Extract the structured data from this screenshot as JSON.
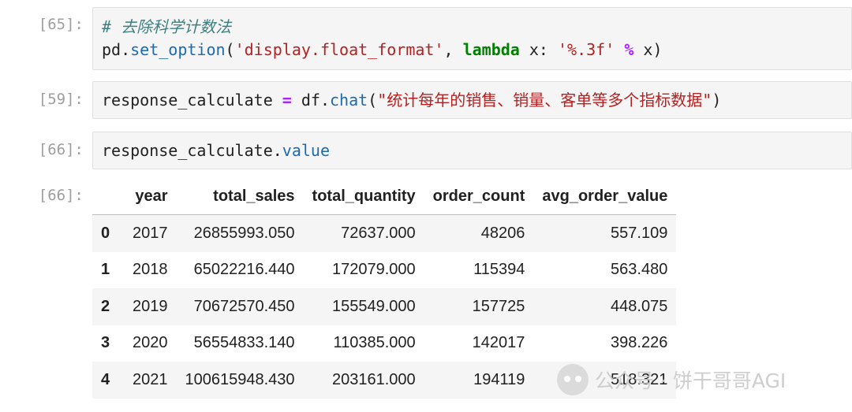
{
  "cells": [
    {
      "prompt": "[65]:",
      "comment": "# 去除科学计数法",
      "code": {
        "part1": "pd.",
        "fn": "set_option",
        "part2": "(",
        "str1": "'display.float_format'",
        "part3": ", ",
        "kw": "lambda",
        "part4": " x: ",
        "str2": "'%.3f'",
        "part5": " ",
        "op": "%",
        "part6": " x)"
      }
    },
    {
      "prompt": "[59]:",
      "code": {
        "part1": "response_calculate ",
        "op": "=",
        "part2": " df.",
        "fn": "chat",
        "part3": "(",
        "str": "\"统计每年的销售、销量、客单等多个指标数据\"",
        "part4": ")"
      }
    },
    {
      "prompt": "[66]:",
      "code": {
        "part1": "response_calculate.",
        "fn": "value"
      }
    }
  ],
  "output": {
    "prompt": "[66]:",
    "columns": [
      "year",
      "total_sales",
      "total_quantity",
      "order_count",
      "avg_order_value"
    ],
    "rows": [
      {
        "index": "0",
        "values": [
          "2017",
          "26855993.050",
          "72637.000",
          "48206",
          "557.109"
        ]
      },
      {
        "index": "1",
        "values": [
          "2018",
          "65022216.440",
          "172079.000",
          "115394",
          "563.480"
        ]
      },
      {
        "index": "2",
        "values": [
          "2019",
          "70672570.450",
          "155549.000",
          "157725",
          "448.075"
        ]
      },
      {
        "index": "3",
        "values": [
          "2020",
          "56554833.140",
          "110385.000",
          "142017",
          "398.226"
        ]
      },
      {
        "index": "4",
        "values": [
          "2021",
          "100615948.430",
          "203161.000",
          "194119",
          "518.321"
        ]
      }
    ]
  },
  "watermark": {
    "text": "公众号 · 饼干哥哥AGI",
    "icon": "wechat-icon"
  }
}
